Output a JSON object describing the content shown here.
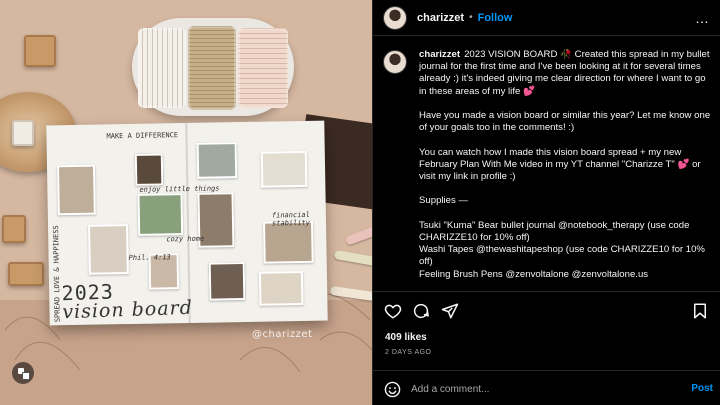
{
  "post": {
    "username": "charizzet",
    "follow_label": "Follow",
    "separator": "•",
    "more_label": "…",
    "caption_paragraphs": [
      "2023 VISION BOARD 🥀 Created this spread in my bullet journal for the first time and I've been looking at it for several times already :) it's indeed giving me clear direction for where I want to go in these areas of my life 💕",
      "Have you made a vision board or similar this year? Let me know one of your goals too in the comments! :)",
      "You can watch how I made this vision board spread + my new February Plan With Me video in my YT channel \"Charizze T\" 💕 or visit my link in profile :)",
      "Supplies —",
      "Tsuki \"Kuma\" Bear bullet journal @notebook_therapy (use code CHARIZZE10 for 10% off)\nWashi Tapes @thewashitapeshop (use code CHARIZZE10 for 10% off)\nFeeling Brush Pens @zenvoltalone @zenvoltalone.us"
    ],
    "likes": "409 likes",
    "date": "2 DAYS AGO",
    "comment_placeholder": "Add a comment...",
    "post_label": "Post"
  },
  "image": {
    "title_line1": "2023",
    "title_line2": "vision board",
    "watermark": "@charizzet",
    "journal_labels": [
      "MAKE A DIFFERENCE",
      "SPREAD LOVE & HAPPINESS",
      "enjoy little things",
      "cozy home",
      "Phil. 4:13",
      "financial stability"
    ]
  },
  "icons": {
    "like": "heart-icon",
    "comment": "comment-icon",
    "share": "paper-plane-icon",
    "save": "bookmark-icon",
    "emoji": "smiley-icon",
    "carousel": "multiple-images-icon"
  },
  "colors": {
    "accent": "#0095f6",
    "background": "#000000",
    "text": "#f5f5f5",
    "muted": "#a8a8a8"
  }
}
